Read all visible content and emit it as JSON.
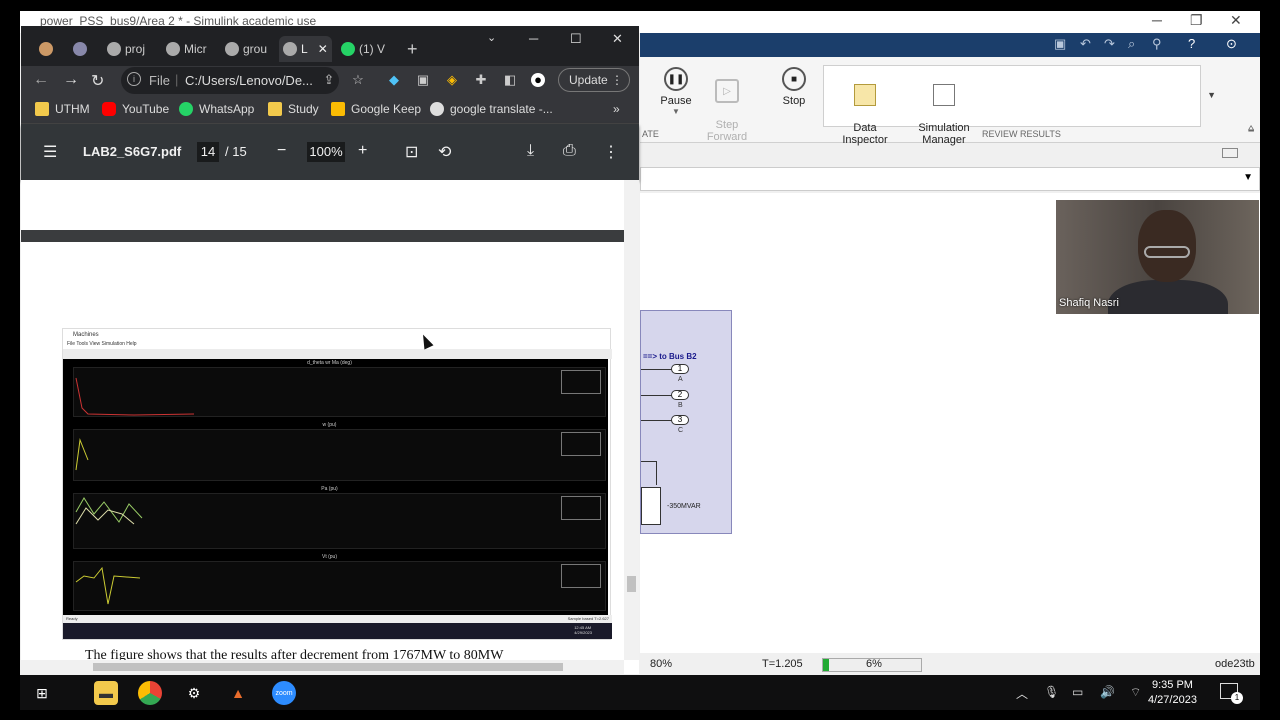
{
  "simulink": {
    "title": "power_PSS_bus9/Area 2 * - Simulink academic use",
    "buttons": {
      "pause": "Pause",
      "step_forward": "Step\nForward",
      "stop": "Stop",
      "data_inspector": "Data\nInspector",
      "simulation_manager": "Simulation\nManager"
    },
    "group_labels": {
      "simulate_tail": "ATE",
      "review": "REVIEW RESULTS"
    },
    "block": {
      "bus_label": "==> to Bus B2",
      "ports": [
        {
          "num": "1",
          "label": "A"
        },
        {
          "num": "2",
          "label": "B"
        },
        {
          "num": "3",
          "label": "C"
        }
      ],
      "cap_label": "-350MVAR"
    },
    "status": {
      "zoom": "80%",
      "time": "T=1.205",
      "progress_text": "6%",
      "progress": 0.06,
      "solver": "ode23tb"
    }
  },
  "camera": {
    "name": "Shafiq Nasri"
  },
  "chrome": {
    "tabs": [
      {
        "label": "proj"
      },
      {
        "label": "Micr"
      },
      {
        "label": "grou"
      },
      {
        "label": "L"
      },
      {
        "label": "(1) V"
      }
    ],
    "url_prefix": "File",
    "url": "C:/Users/Lenovo/De...",
    "update_label": "Update",
    "bookmarks": [
      {
        "label": "UTHM",
        "icon": "folder-icon",
        "color": "#f2c94c"
      },
      {
        "label": "YouTube",
        "icon": "youtube-icon",
        "color": "#ff0000"
      },
      {
        "label": "WhatsApp",
        "icon": "whatsapp-icon",
        "color": "#25d366"
      },
      {
        "label": "Study",
        "icon": "folder-icon",
        "color": "#f2c94c"
      },
      {
        "label": "Google Keep",
        "icon": "keep-icon",
        "color": "#fbbc04"
      },
      {
        "label": "google translate -...",
        "icon": "google-icon",
        "color": "#dddddd"
      }
    ]
  },
  "pdf": {
    "filename": "LAB2_S6G7.pdf",
    "page": "14",
    "total": "/ 15",
    "zoom": "100%",
    "caption": "The figure shows that the results after decrement from 1767MW to 80MW",
    "embedded": {
      "window_title": "Machines",
      "menu": "File   Tools   View   Simulation   Help",
      "panels": [
        "d_theta wr Ma (deg)",
        "w (pu)",
        "Pa (pu)",
        "Vt (pu)"
      ],
      "status_left": "Ready",
      "status_right": "Sample based   T=2.627",
      "clock": "12:45 AM\n4/29/2023"
    }
  },
  "taskbar": {
    "time": "9:35 PM",
    "date": "4/27/2023",
    "notifications": "1"
  }
}
